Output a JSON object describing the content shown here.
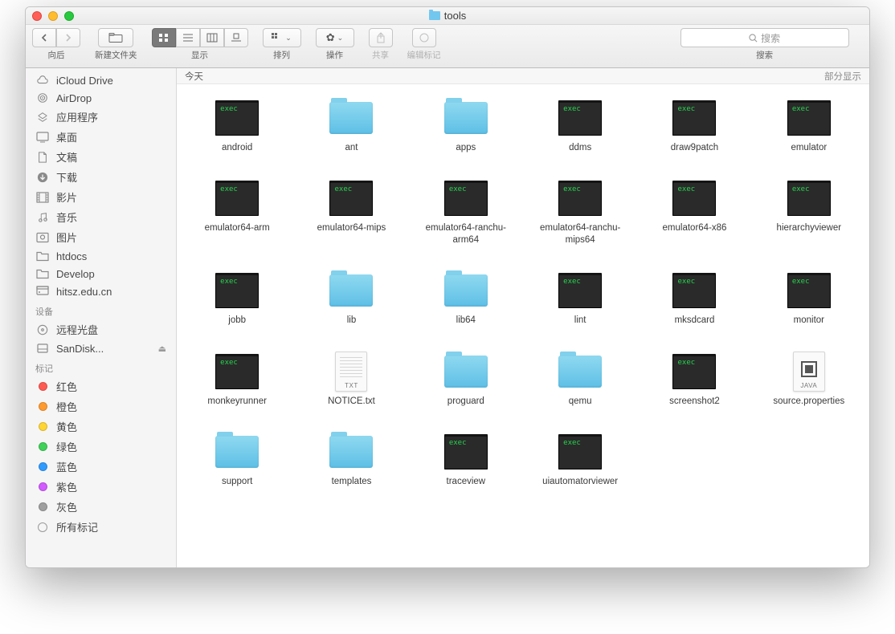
{
  "window": {
    "title": "tools"
  },
  "toolbar": {
    "nav_label": "向后",
    "newfolder_label": "新建文件夹",
    "view_label": "显示",
    "arrange_label": "排列",
    "action_label": "操作",
    "share_label": "共享",
    "edittags_label": "编辑标记",
    "search_label": "搜索",
    "search_placeholder": "搜索"
  },
  "sidebar": {
    "favorites": [
      {
        "label": "iCloud Drive",
        "icon": "cloud"
      },
      {
        "label": "AirDrop",
        "icon": "airdrop"
      },
      {
        "label": "应用程序",
        "icon": "app"
      },
      {
        "label": "桌面",
        "icon": "desktop"
      },
      {
        "label": "文稿",
        "icon": "doc"
      },
      {
        "label": "下载",
        "icon": "download"
      },
      {
        "label": "影片",
        "icon": "movie"
      },
      {
        "label": "音乐",
        "icon": "music"
      },
      {
        "label": "图片",
        "icon": "picture"
      },
      {
        "label": "htdocs",
        "icon": "folder"
      },
      {
        "label": "Develop",
        "icon": "folder"
      },
      {
        "label": "hitsz.edu.cn",
        "icon": "server"
      }
    ],
    "devices_label": "设备",
    "devices": [
      {
        "label": "远程光盘",
        "icon": "disc",
        "eject": false
      },
      {
        "label": "SanDisk...",
        "icon": "disk",
        "eject": true
      }
    ],
    "tags_label": "标记",
    "tags": [
      {
        "label": "红色",
        "color": "#ff5a52"
      },
      {
        "label": "橙色",
        "color": "#ff9a2e"
      },
      {
        "label": "黄色",
        "color": "#ffd533"
      },
      {
        "label": "绿色",
        "color": "#3fd158"
      },
      {
        "label": "蓝色",
        "color": "#2f9bff"
      },
      {
        "label": "紫色",
        "color": "#d25aff"
      },
      {
        "label": "灰色",
        "color": "#9f9f9f"
      }
    ],
    "alltags_label": "所有标记"
  },
  "content": {
    "group_header": "今天",
    "right_hint": "部分显示",
    "items": [
      {
        "name": "android",
        "type": "exec"
      },
      {
        "name": "ant",
        "type": "folder"
      },
      {
        "name": "apps",
        "type": "folder"
      },
      {
        "name": "ddms",
        "type": "exec"
      },
      {
        "name": "draw9patch",
        "type": "exec"
      },
      {
        "name": "emulator",
        "type": "exec"
      },
      {
        "name": "emulator64-arm",
        "type": "exec"
      },
      {
        "name": "emulator64-mips",
        "type": "exec"
      },
      {
        "name": "emulator64-ranchu-arm64",
        "type": "exec"
      },
      {
        "name": "emulator64-ranchu-mips64",
        "type": "exec"
      },
      {
        "name": "emulator64-x86",
        "type": "exec"
      },
      {
        "name": "hierarchyviewer",
        "type": "exec"
      },
      {
        "name": "jobb",
        "type": "exec"
      },
      {
        "name": "lib",
        "type": "folder"
      },
      {
        "name": "lib64",
        "type": "folder"
      },
      {
        "name": "lint",
        "type": "exec"
      },
      {
        "name": "mksdcard",
        "type": "exec"
      },
      {
        "name": "monitor",
        "type": "exec"
      },
      {
        "name": "monkeyrunner",
        "type": "exec"
      },
      {
        "name": "NOTICE.txt",
        "type": "txt"
      },
      {
        "name": "proguard",
        "type": "folder"
      },
      {
        "name": "qemu",
        "type": "folder"
      },
      {
        "name": "screenshot2",
        "type": "exec"
      },
      {
        "name": "source.properties",
        "type": "java"
      },
      {
        "name": "support",
        "type": "folder"
      },
      {
        "name": "templates",
        "type": "folder"
      },
      {
        "name": "traceview",
        "type": "exec"
      },
      {
        "name": "uiautomatorviewer",
        "type": "exec"
      }
    ]
  }
}
